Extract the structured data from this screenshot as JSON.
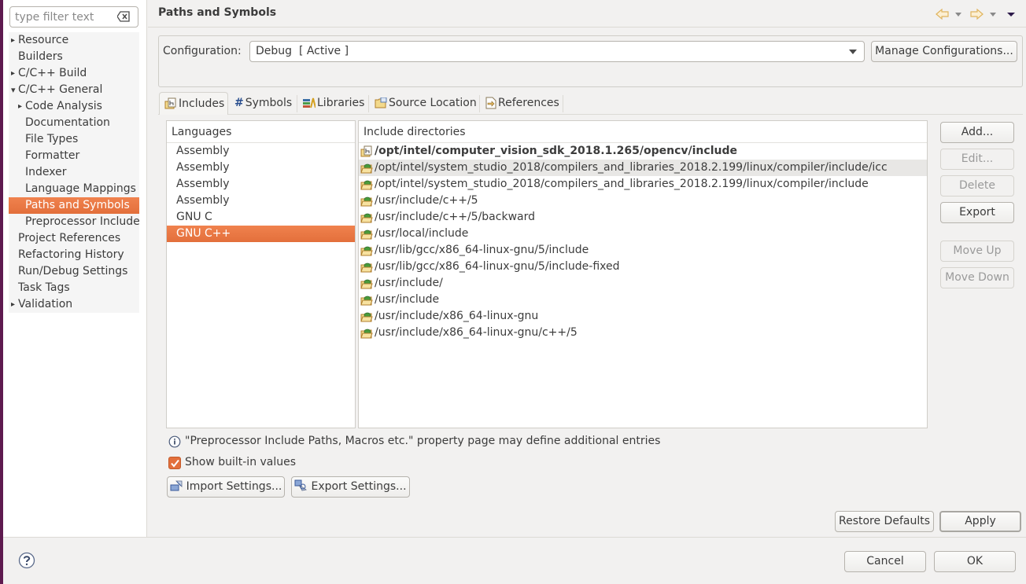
{
  "sidebar": {
    "filter_placeholder": "type filter text",
    "filter_value": "",
    "items": [
      {
        "label": "Resource",
        "level": 0,
        "expander": "collapsed"
      },
      {
        "label": "Builders",
        "level": 0,
        "expander": "none"
      },
      {
        "label": "C/C++ Build",
        "level": 0,
        "expander": "collapsed"
      },
      {
        "label": "C/C++ General",
        "level": 0,
        "expander": "expanded"
      },
      {
        "label": "Code Analysis",
        "level": 1,
        "expander": "collapsed"
      },
      {
        "label": "Documentation",
        "level": 1,
        "expander": "none"
      },
      {
        "label": "File Types",
        "level": 1,
        "expander": "none"
      },
      {
        "label": "Formatter",
        "level": 1,
        "expander": "none"
      },
      {
        "label": "Indexer",
        "level": 1,
        "expander": "none"
      },
      {
        "label": "Language Mappings",
        "level": 1,
        "expander": "none"
      },
      {
        "label": "Paths and Symbols",
        "level": 1,
        "expander": "none",
        "selected": true
      },
      {
        "label": "Preprocessor Include",
        "level": 1,
        "expander": "none"
      },
      {
        "label": "Project References",
        "level": 0,
        "expander": "none"
      },
      {
        "label": "Refactoring History",
        "level": 0,
        "expander": "none"
      },
      {
        "label": "Run/Debug Settings",
        "level": 0,
        "expander": "none"
      },
      {
        "label": "Task Tags",
        "level": 0,
        "expander": "none"
      },
      {
        "label": "Validation",
        "level": 0,
        "expander": "collapsed"
      }
    ]
  },
  "header": {
    "title": "Paths and Symbols",
    "nav_icons": [
      "back-arrow-icon",
      "back-dropdown-icon",
      "forward-arrow-icon",
      "forward-dropdown-icon",
      "view-menu-icon"
    ]
  },
  "configuration": {
    "label": "Configuration:",
    "selected": "Debug  [ Active ]",
    "manage_button": "Manage Configurations..."
  },
  "tabs": [
    {
      "label": "Includes",
      "icon": "includes-icon",
      "active": true
    },
    {
      "label": "Symbols",
      "icon": "hash-icon",
      "active": false
    },
    {
      "label": "Libraries",
      "icon": "libraries-icon",
      "active": false
    },
    {
      "label": "Source Location",
      "icon": "source-folder-icon",
      "active": false
    },
    {
      "label": "References",
      "icon": "references-icon",
      "active": false
    }
  ],
  "languages": {
    "header": "Languages",
    "rows": [
      "Assembly",
      "Assembly",
      "Assembly",
      "Assembly",
      "GNU C",
      "GNU C++"
    ],
    "selected_index": 5
  },
  "include_dirs": {
    "header": "Include directories",
    "rows": [
      {
        "path": "/opt/intel/computer_vision_sdk_2018.1.265/opencv/include",
        "bold": true,
        "icon": "user-include-folder-icon"
      },
      {
        "path": "/opt/intel/system_studio_2018/compilers_and_libraries_2018.2.199/linux/compiler/include/icc",
        "bold": false,
        "icon": "builtin-include-folder-icon",
        "highlighted": true
      },
      {
        "path": "/opt/intel/system_studio_2018/compilers_and_libraries_2018.2.199/linux/compiler/include",
        "bold": false,
        "icon": "builtin-include-folder-icon"
      },
      {
        "path": "/usr/include/c++/5",
        "bold": false,
        "icon": "builtin-include-folder-icon"
      },
      {
        "path": "/usr/include/c++/5/backward",
        "bold": false,
        "icon": "builtin-include-folder-icon"
      },
      {
        "path": "/usr/local/include",
        "bold": false,
        "icon": "builtin-include-folder-icon"
      },
      {
        "path": "/usr/lib/gcc/x86_64-linux-gnu/5/include",
        "bold": false,
        "icon": "builtin-include-folder-icon"
      },
      {
        "path": "/usr/lib/gcc/x86_64-linux-gnu/5/include-fixed",
        "bold": false,
        "icon": "builtin-include-folder-icon"
      },
      {
        "path": "/usr/include/",
        "bold": false,
        "icon": "builtin-include-folder-icon"
      },
      {
        "path": "/usr/include",
        "bold": false,
        "icon": "builtin-include-folder-icon"
      },
      {
        "path": "/usr/include/x86_64-linux-gnu",
        "bold": false,
        "icon": "builtin-include-folder-icon"
      },
      {
        "path": "/usr/include/x86_64-linux-gnu/c++/5",
        "bold": false,
        "icon": "builtin-include-folder-icon"
      }
    ]
  },
  "side_buttons": {
    "add": "Add...",
    "edit": "Edit...",
    "delete": "Delete",
    "export": "Export",
    "move_up": "Move Up",
    "move_down": "Move Down"
  },
  "info_text": "\"Preprocessor Include Paths, Macros etc.\" property page may define additional entries",
  "show_builtin": {
    "label": "Show built-in values",
    "checked": true
  },
  "import_settings": "Import Settings...",
  "export_settings": "Export Settings...",
  "restore_defaults": "Restore Defaults",
  "apply": "Apply",
  "cancel": "Cancel",
  "ok": "OK",
  "colors": {
    "selection": "#e9763f",
    "background": "#f2f1f0",
    "window_edge": "#5e1a4f"
  }
}
